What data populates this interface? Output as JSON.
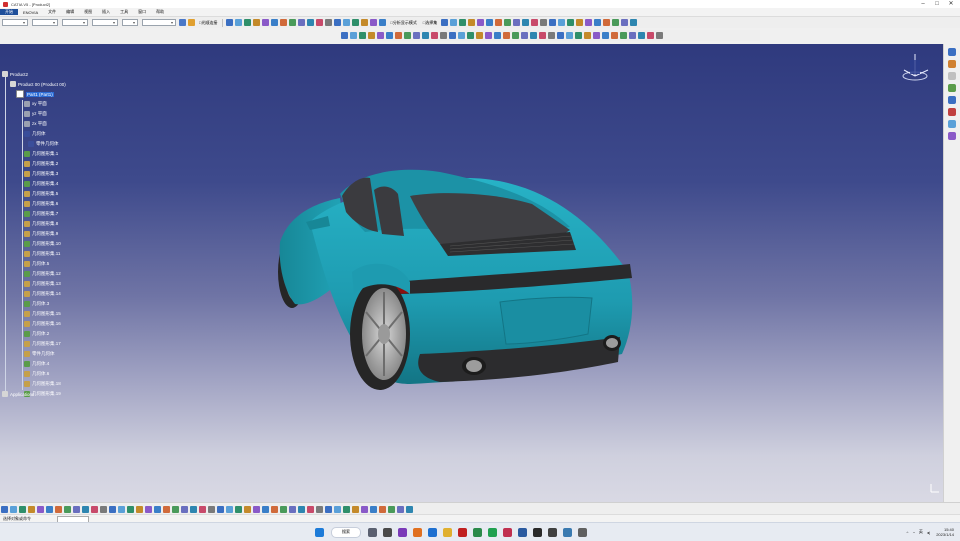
{
  "window": {
    "title": "CATIA V5 - [Product2]",
    "controls": [
      "–",
      "□",
      "✕"
    ]
  },
  "menu": [
    "开始",
    "ENOVIA",
    "文件",
    "编辑",
    "视图",
    "插入",
    "工具",
    "窗口",
    "帮助"
  ],
  "toolbar": {
    "combos": [
      {
        "value": "",
        "width": 22
      },
      {
        "value": "",
        "width": 26
      },
      {
        "value": "",
        "width": 26
      },
      {
        "value": "",
        "width": 26
      },
      {
        "value": "",
        "width": 16
      },
      {
        "value": "",
        "width": 34
      }
    ],
    "checkbox_1": "□光顺连接",
    "checkbox_2": "□分析显示模式",
    "checkbox_3": "□选择集",
    "checkbox_4": "□自动"
  },
  "tree": {
    "root": "Product2",
    "product": "Product 00 (Product 00)",
    "part": "Part1 (Part1)",
    "plane_xy": "xy 平面",
    "plane_yz": "yz 平面",
    "plane_zx": "zx 平面",
    "body": "零件几何体",
    "bodies_label": "几何体",
    "items": [
      "几何图形集.1",
      "几何图形集.2",
      "几何图形集.3",
      "几何图形集.4",
      "几何图形集.5",
      "几何图形集.6",
      "几何图形集.7",
      "几何图形集.8",
      "几何图形集.9",
      "几何图形集.10",
      "几何图形集.11",
      "几何体.5",
      "几何图形集.12",
      "几何图形集.13",
      "几何图形集.14",
      "几何体.3",
      "几何图形集.15",
      "几何图形集.16",
      "几何体.2",
      "几何图形集.17",
      "零件几何体",
      "几何体.4",
      "几何体.6",
      "几何图形集.18",
      "几何图形集.19"
    ],
    "applications": "Applications"
  },
  "status": {
    "message": "选择对象或命令"
  },
  "taskbar": {
    "search": "搜索",
    "ime": "英",
    "time": "15:40",
    "date": "2023/1/14"
  },
  "colors": {
    "car_body": "#1e9bb0",
    "car_body_dark": "#137585",
    "glass": "#3b3b3f",
    "tire": "#2a2a2a",
    "rim": "#b8b8b8",
    "viewport_top": "#2f3a7e",
    "viewport_bottom": "#d9d9e4"
  }
}
